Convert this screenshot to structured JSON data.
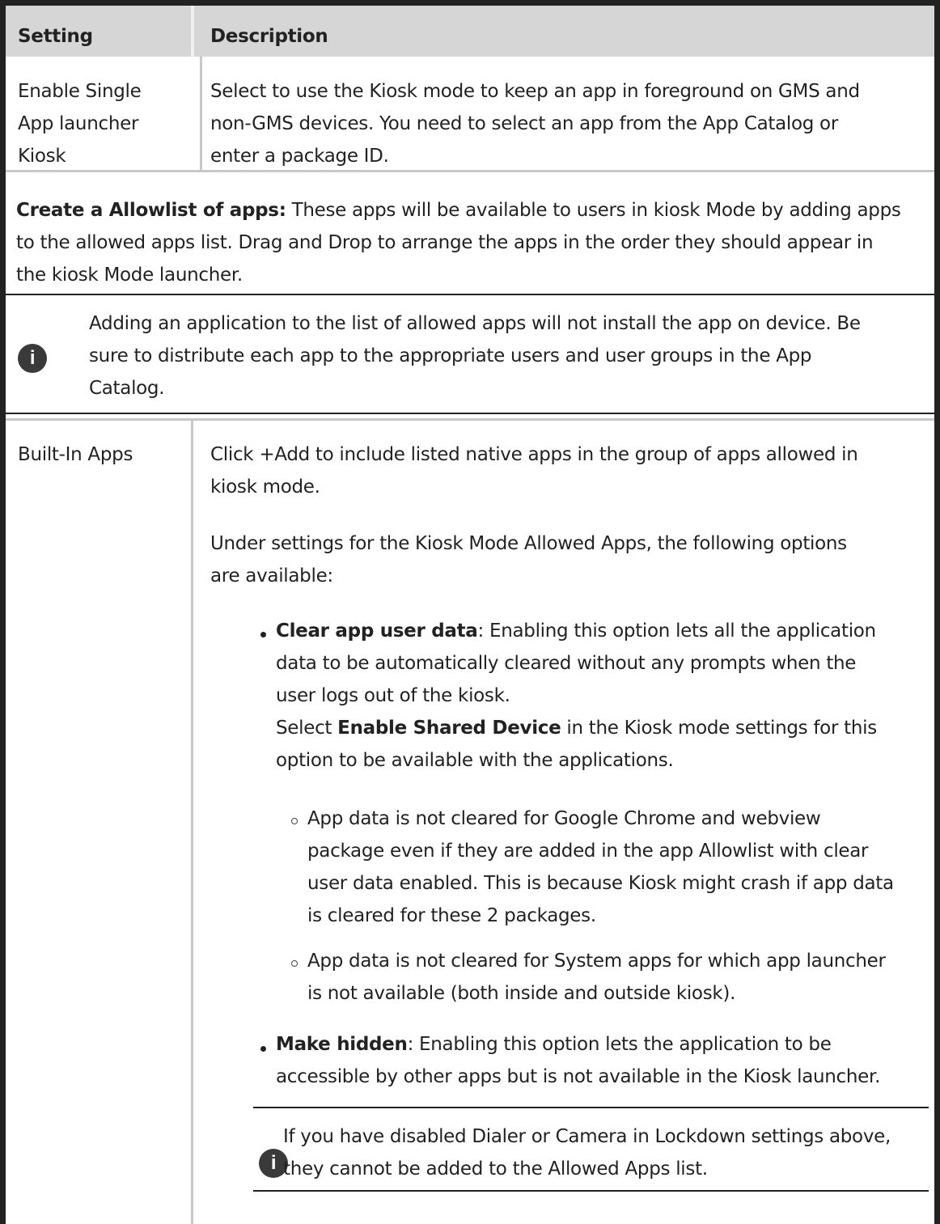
{
  "table": {
    "headers": {
      "setting": "Setting",
      "description": "Description"
    },
    "row1": {
      "setting_lines": [
        "Enable Single",
        "App launcher",
        "Kiosk"
      ],
      "description_lines": [
        "Select to use the Kiosk mode to keep an app in foreground on GMS and",
        "non-GMS devices. You need to select an app from the App Catalog or",
        "enter a package ID."
      ]
    },
    "allowlist": {
      "bold_lead": "Create a Allowlist of apps:",
      "line1_rest": " These apps will be available to users in kiosk Mode by adding apps",
      "line2": "to the allowed apps list. Drag and Drop to arrange the apps in the order they should appear in",
      "line3": "the kiosk Mode launcher."
    },
    "note1": {
      "icon": "info-icon",
      "lines": [
        "Adding an application to the list of allowed apps will not install the app on device. Be",
        "sure to distribute each app to the appropriate users and user groups in the App",
        "Catalog."
      ]
    },
    "row2": {
      "setting": "Built-In Apps",
      "p1_lines": [
        "Click +Add to include listed native apps in the group of apps allowed in",
        "kiosk mode."
      ],
      "p2_lines": [
        "Under settings for the Kiosk Mode Allowed Apps, the following options",
        "are available:"
      ],
      "bullet1": {
        "bold": "Clear app user data",
        "rest_line1": ": Enabling this option lets all the application",
        "line2": "data to be automatically cleared without any prompts when the",
        "line3": "user logs out of the kiosk.",
        "line4_pre": "Select ",
        "line4_bold": "Enable Shared Device",
        "line4_post": " in the Kiosk mode settings for this",
        "line5": "option to be available with the applications."
      },
      "sub1_lines": [
        "App data is not cleared for Google Chrome and webview",
        "package even if they are added in the app Allowlist with clear",
        "user data enabled. This is because Kiosk might crash if app data",
        "is cleared for these 2 packages."
      ],
      "sub2_lines": [
        "App data is not cleared for System apps for which app launcher",
        "is not available (both inside and outside kiosk)."
      ],
      "bullet2": {
        "bold": "Make hidden",
        "rest_line1": ": Enabling this option lets the application to be",
        "line2": "accessible by other apps but is not available in the Kiosk launcher."
      },
      "note2": {
        "icon": "info-icon",
        "lines": [
          "If you have disabled Dialer or Camera in Lockdown settings above,",
          "they cannot be added to the Allowed Apps list."
        ]
      }
    }
  }
}
